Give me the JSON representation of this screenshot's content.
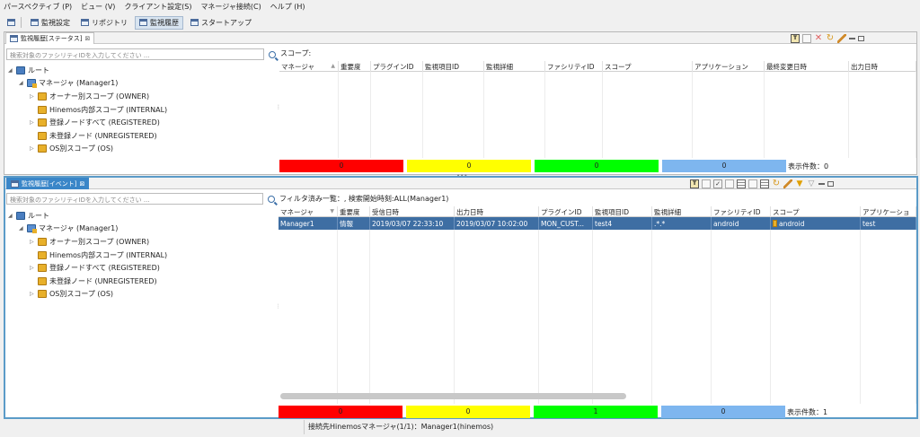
{
  "menubar": [
    "パースペクティブ (P)",
    "ビュー (V)",
    "クライアント設定(S)",
    "マネージャ接続(C)",
    "ヘルプ (H)"
  ],
  "perspectives": [
    {
      "label": "監視設定",
      "active": false
    },
    {
      "label": "リポジトリ",
      "active": false
    },
    {
      "label": "監視履歴",
      "active": true
    },
    {
      "label": "スタートアップ",
      "active": false
    }
  ],
  "status_view": {
    "tab_title": "監視履歴[ステータス]",
    "search_placeholder": "検索対象のファシリティIDを入力してください ...",
    "scope_label": "スコープ:",
    "columns": [
      "マネージャ",
      "重要度",
      "プラグインID",
      "監視項目ID",
      "監視詳細",
      "ファシリティID",
      "スコープ",
      "アプリケーション",
      "最終変更日時",
      "出力日時"
    ],
    "counts": [
      "0",
      "0",
      "0",
      "0"
    ],
    "count_label": "表示件数：0"
  },
  "tree": {
    "root": "ルート",
    "manager": "マネージャ (Manager1)",
    "scopes": [
      "オーナー別スコープ (OWNER)",
      "Hinemos内部スコープ (INTERNAL)",
      "登録ノードすべて (REGISTERED)",
      "未登録ノード (UNREGISTERED)",
      "OS別スコープ (OS)"
    ]
  },
  "event_view": {
    "tab_title": "監視履歴[イベント]",
    "search_placeholder": "検索対象のファシリティIDを入力してください ...",
    "filter_label": "フィルタ済み一覧：,   検索開始時刻:ALL(Manager1)",
    "columns": [
      "マネージャ",
      "重要度",
      "受信日時",
      "出力日時",
      "プラグインID",
      "監視項目ID",
      "監視詳細",
      "ファシリティID",
      "スコープ",
      "アプリケーショ"
    ],
    "row": [
      "Manager1",
      "情報",
      "2019/03/07 22:33:10",
      "2019/03/07 10:02:00",
      "MON_CUST...",
      "test4",
      ".*.*",
      "android",
      "android",
      "test"
    ],
    "counts": [
      "0",
      "0",
      "1",
      "0"
    ],
    "count_label": "表示件数：1"
  },
  "status_colors": [
    "#ff0000",
    "#ffff00",
    "#00ff00",
    "#7eb6ef"
  ],
  "bottom_status": "接続先Hinemosマネージャ(1/1)：Manager1(hinemos)"
}
